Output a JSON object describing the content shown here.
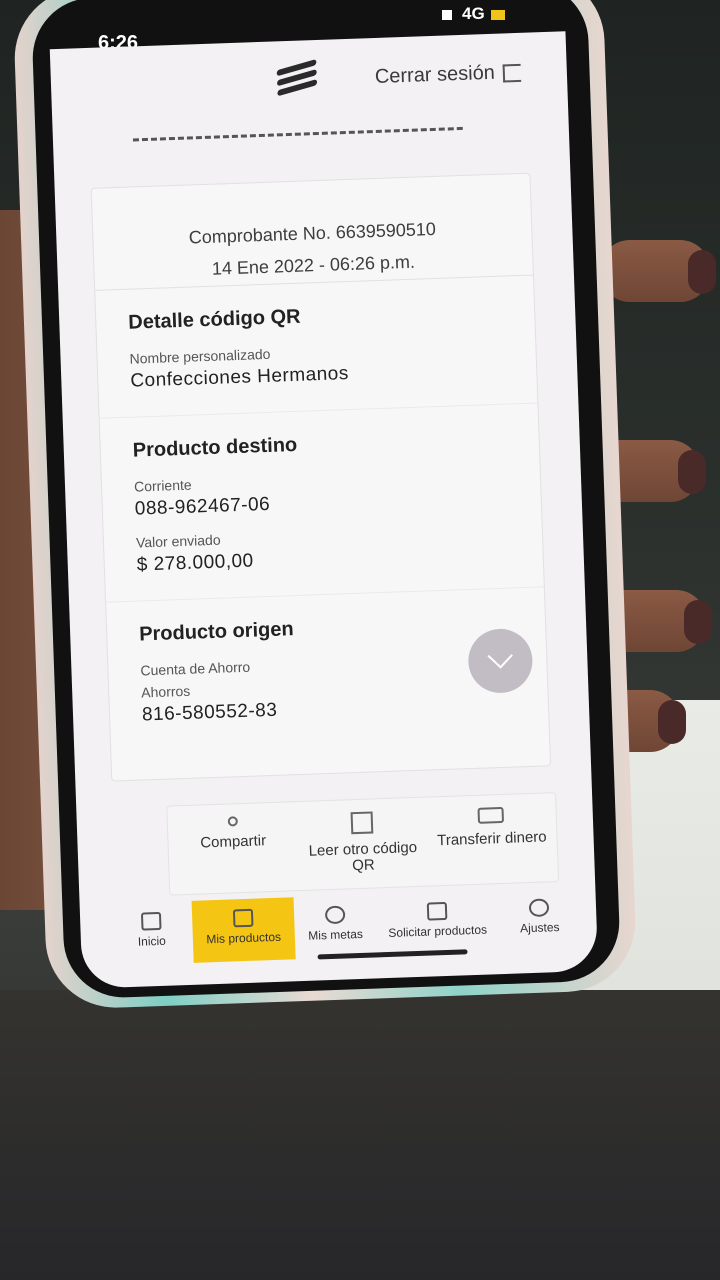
{
  "status_bar": {
    "time": "6:26",
    "network": "4G"
  },
  "header": {
    "logout_label": "Cerrar sesión"
  },
  "receipt": {
    "number_text": "Comprobante No. 6639590510",
    "datetime": "14 Ene 2022 - 06:26 p.m."
  },
  "qr_detail": {
    "title": "Detalle código QR",
    "name_label": "Nombre personalizado",
    "name_value": "Confecciones Hermanos"
  },
  "destination": {
    "title": "Producto destino",
    "account_type": "Corriente",
    "account_number": "088-962467-06",
    "amount_label": "Valor enviado",
    "amount_value": "$ 278.000,00"
  },
  "origin": {
    "title": "Producto origen",
    "account_label": "Cuenta de Ahorro",
    "account_type": "Ahorros",
    "account_number": "816-580552-83"
  },
  "actions": [
    {
      "label": "Compartir",
      "icon": "share-icon"
    },
    {
      "label": "Leer otro código QR",
      "icon": "qr-code-icon"
    },
    {
      "label": "Transferir dinero",
      "icon": "money-icon"
    }
  ],
  "tabs": [
    {
      "label": "Inicio",
      "icon": "home-icon"
    },
    {
      "label": "Mis productos",
      "icon": "card-icon",
      "active": true
    },
    {
      "label": "Mis metas",
      "icon": "target-icon"
    },
    {
      "label": "Solicitar productos",
      "icon": "cart-icon"
    },
    {
      "label": "Ajustes",
      "icon": "gear-icon"
    }
  ],
  "colors": {
    "accent": "#f5c514",
    "screen_bg": "#f3f1f3",
    "text": "#222222"
  }
}
